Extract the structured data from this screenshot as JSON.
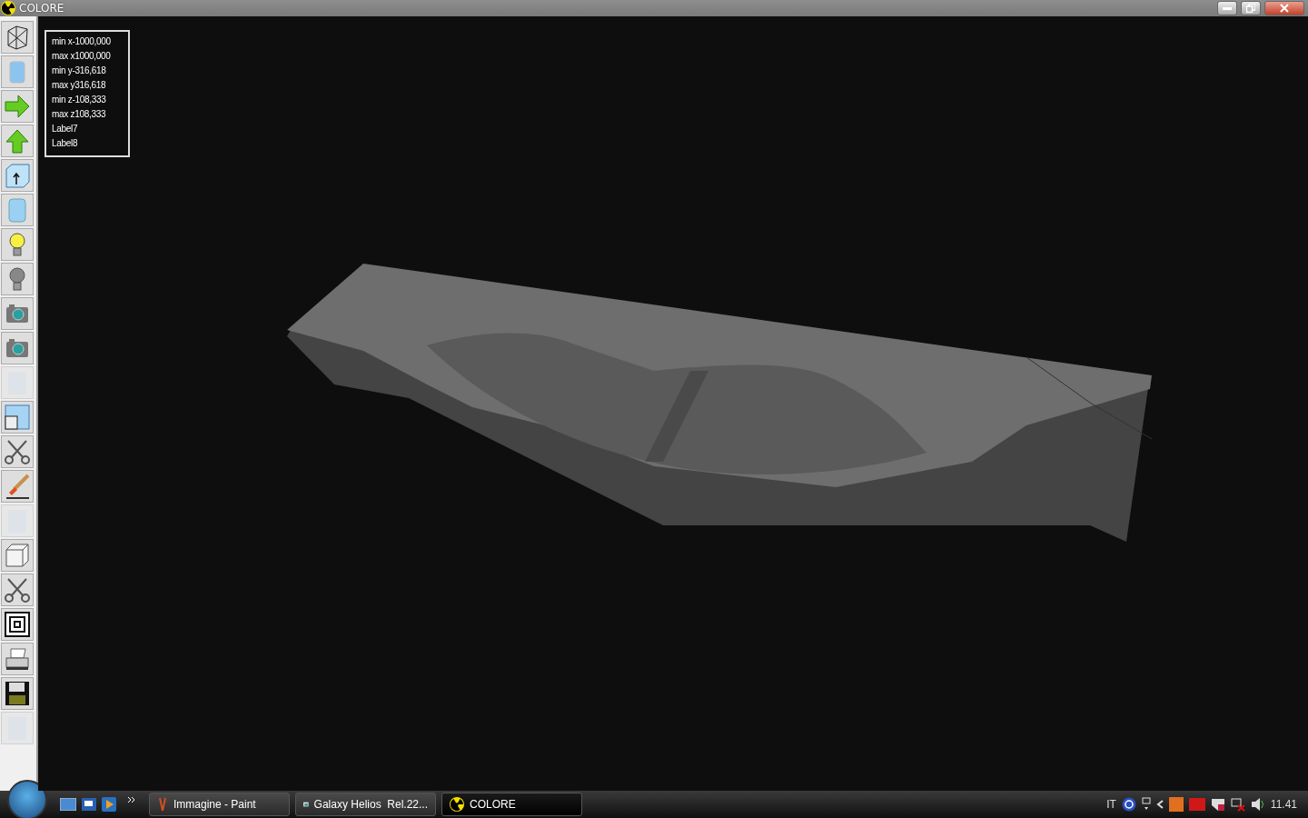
{
  "window": {
    "title": "COLORE"
  },
  "tools": [
    {
      "kind": "wireframe",
      "disabled": false
    },
    {
      "kind": "solid",
      "disabled": false
    },
    {
      "kind": "arrow-right",
      "disabled": false
    },
    {
      "kind": "arrow-up",
      "disabled": false
    },
    {
      "kind": "box-up",
      "disabled": false
    },
    {
      "kind": "cylinder",
      "disabled": false
    },
    {
      "kind": "bulb-on",
      "disabled": false
    },
    {
      "kind": "bulb-off",
      "disabled": false
    },
    {
      "kind": "camera",
      "disabled": false
    },
    {
      "kind": "camera",
      "disabled": false
    },
    {
      "kind": "texture",
      "disabled": true
    },
    {
      "kind": "window",
      "disabled": false
    },
    {
      "kind": "scissors",
      "disabled": false
    },
    {
      "kind": "brush",
      "disabled": false
    },
    {
      "kind": "texture",
      "disabled": true
    },
    {
      "kind": "cube",
      "disabled": false
    },
    {
      "kind": "scissors",
      "disabled": false
    },
    {
      "kind": "squares",
      "disabled": false
    },
    {
      "kind": "printer",
      "disabled": false
    },
    {
      "kind": "floppy",
      "disabled": false
    },
    {
      "kind": "texture",
      "disabled": true
    }
  ],
  "info_panel": {
    "lines": [
      "min x-1000,000",
      "max x1000,000",
      "min y-316,618",
      "max y316,618",
      "min z-108,333",
      "max z108,333",
      "Label7",
      "Label8"
    ]
  },
  "taskbar": {
    "tasks": [
      {
        "label": "Immagine - Paint",
        "kind": "paint",
        "selected": false
      },
      {
        "label": "Galaxy Helios  Rel.22...",
        "kind": "app",
        "selected": false
      },
      {
        "label": "COLORE",
        "kind": "radiation",
        "selected": true
      }
    ],
    "language": "IT",
    "clock": "11.41"
  }
}
